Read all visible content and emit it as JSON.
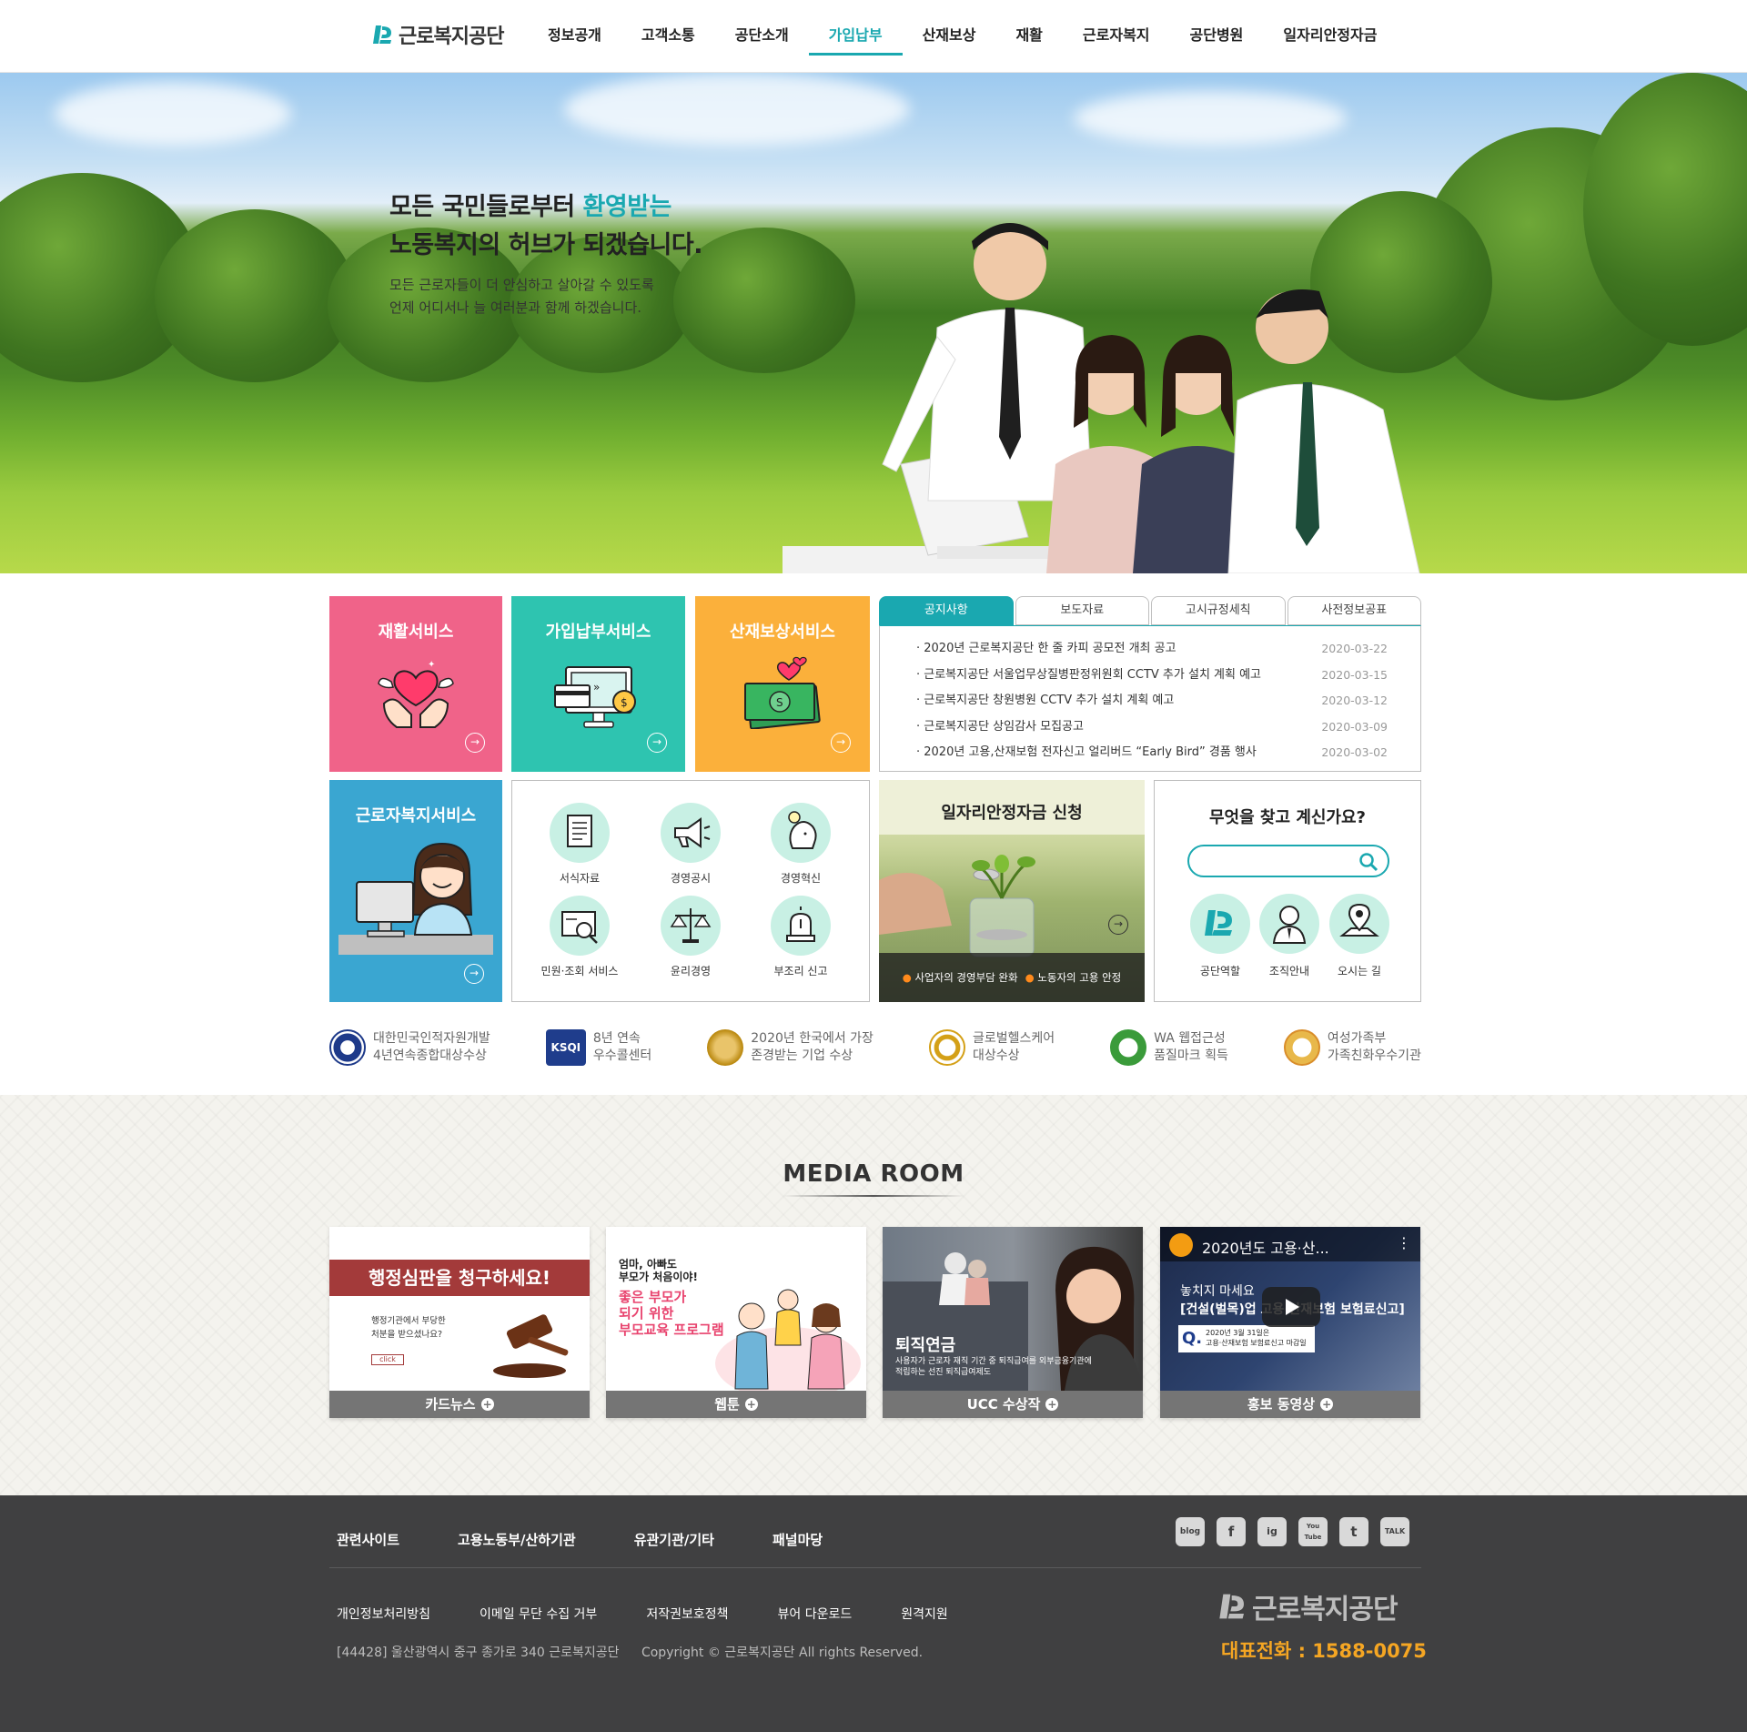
{
  "header": {
    "logo_text": "근로복지공단",
    "nav": [
      "정보공개",
      "고객소통",
      "공단소개",
      "가입납부",
      "산재보상",
      "재활",
      "근로자복지",
      "공단병원",
      "일자리안정자금"
    ],
    "active_nav": "가입납부"
  },
  "hero": {
    "line1_pre": "모든 국민들로부터 ",
    "line1_accent": "환영받는",
    "line2": "노동복지의 허브가 되겠습니다.",
    "sub1": "모든 근로자들이 더 안심하고 살아갈 수 있도록",
    "sub2": "언제 어디서나 늘 여러분과 함께 하겠습니다."
  },
  "tiles": {
    "rehab": "재활서비스",
    "subscribe": "가입납부서비스",
    "compensation": "산재보상서비스",
    "welfare": "근로자복지서비스"
  },
  "board": {
    "tabs": [
      "공지사항",
      "보도자료",
      "고시규정세칙",
      "사전정보공표"
    ],
    "notices": [
      {
        "title": "· 2020년 근로복지공단 한 줄 카피 공모전 개최 공고",
        "date": "2020-03-22"
      },
      {
        "title": "· 근로복지공단 서울업무상질병판정위원회 CCTV 추가 설치 계획 예고",
        "date": "2020-03-15"
      },
      {
        "title": "· 근로복지공단 창원병원 CCTV 추가 설치 계획 예고",
        "date": "2020-03-12"
      },
      {
        "title": "· 근로복지공단 상임감사 모집공고",
        "date": "2020-03-09"
      },
      {
        "title": "· 2020년 고용,산재보험 전자신고 얼리버드 “Early Bird” 경품 행사",
        "date": "2020-03-02"
      }
    ]
  },
  "quick": [
    "서식자료",
    "경영공시",
    "경영혁신",
    "민원·조회 서비스",
    "윤리경영",
    "부조리 신고"
  ],
  "fund": {
    "title": "일자리안정자금 신청",
    "item1": "사업자의 경영부담 완화",
    "item2": "노동자의 고용 안정"
  },
  "search": {
    "title": "무엇을 찾고 계신가요?",
    "placeholder": "",
    "links": [
      "공단역할",
      "조직안내",
      "오시는 길"
    ]
  },
  "awards": [
    {
      "l1": "대한민국인적자원개발",
      "l2": "4년연속종합대상수상"
    },
    {
      "l1": "8년 연속",
      "l2": "우수콜센터",
      "badge": "KSQI"
    },
    {
      "l1": "2020년 한국에서 가장",
      "l2": "존경받는 기업 수상"
    },
    {
      "l1": "글로벌헬스케어",
      "l2": "대상수상"
    },
    {
      "l1": "WA 웹접근성",
      "l2": "품질마크 획득"
    },
    {
      "l1": "여성가족부",
      "l2": "가족친화우수기관"
    }
  ],
  "media": {
    "title": "MEDIA ROOM",
    "cards": [
      {
        "caption": "카드뉴스",
        "headline": "행정심판을 청구하세요!",
        "body1": "행정기관에서 부당한",
        "body2": "처분을 받으셨나요?",
        "btn": "click"
      },
      {
        "caption": "웹툰",
        "l1": "엄마, 아빠도",
        "l2": "부모가 처음이야!",
        "l3": "좋은 부모가",
        "l4": "되기 위한",
        "l5": "부모교육 프로그램"
      },
      {
        "caption": "UCC 수상작",
        "title": "퇴직연금",
        "body1": "사용자가 근로자 재직 기간 중 퇴직급여를 외부금융기관에",
        "body2": "적립하는 선진 퇴직급여제도"
      },
      {
        "caption": "홍보 동영상",
        "video_title": "2020년도 고용·산...",
        "l1": "놓치지 마세요",
        "l2": "[건설(벌목)업 고용·산재보험 보험료신고]",
        "q": "Q.",
        "q1": "2020년 3월 31일은",
        "q2": "고용·산재보험 보험료신고 마감일"
      }
    ]
  },
  "footer": {
    "links1": [
      "관련사이트",
      "고용노동부/산하기관",
      "유관기관/기타",
      "패널마당"
    ],
    "sns": [
      "blog",
      "f",
      "ig",
      "You Tube",
      "t",
      "TALK"
    ],
    "links2": [
      "개인정보처리방침",
      "이메일 무단 수집 거부",
      "저작권보호정책",
      "뷰어 다운로드",
      "원격지원"
    ],
    "address": "[44428] 울산광역시 중구 종가로 340 근로복지공단",
    "copyright": "Copyright © 근로복지공단 All rights Reserved.",
    "logo_text": "근로복지공단",
    "phone": "대표전화 : 1588-0075"
  },
  "colors": {
    "accent": "#1aa8b0",
    "rehab": "#f06389",
    "subscribe": "#2ec4b0",
    "compensation": "#fbb03b",
    "welfare": "#3aa6d1",
    "footer": "#404041",
    "phone": "#f5a623"
  }
}
